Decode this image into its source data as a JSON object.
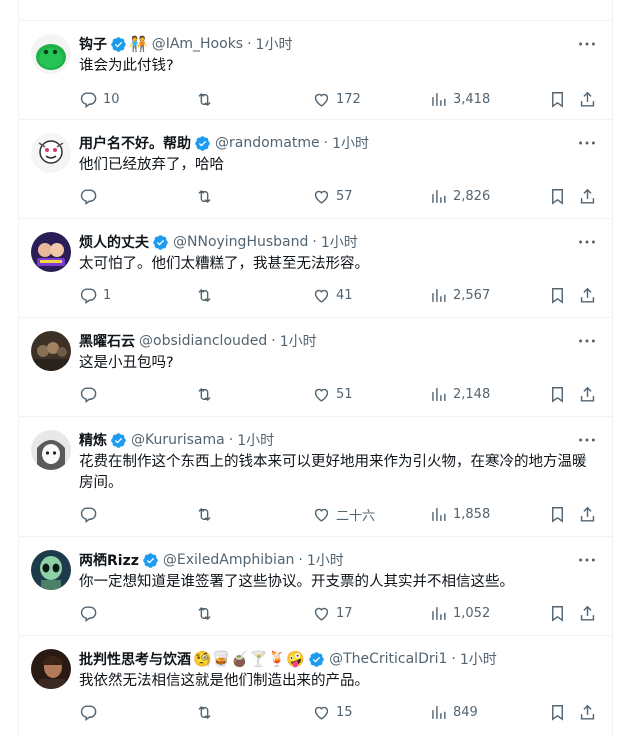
{
  "colors": {
    "verified": "#1d9bf0",
    "secondary_text": "#536471",
    "primary_text": "#0f1419",
    "divider": "#eff3f4"
  },
  "tweets": [
    {
      "name": "钩子",
      "extra_badge": "🧑‍🤝‍🧑",
      "handle": "@IAm_Hooks",
      "time": "1小时",
      "text": "谁会为此付钱?",
      "replies": "10",
      "retweets": "",
      "likes": "172",
      "views": "3,418",
      "avatar": "green-blob"
    },
    {
      "name": "用户名不好。帮助",
      "handle": "@randomatme",
      "time": "1小时",
      "text": "他们已经放弃了，哈哈",
      "replies": "",
      "retweets": "",
      "likes": "57",
      "views": "2,826",
      "avatar": "sketch-face"
    },
    {
      "name": "烦人的丈夫",
      "handle": "@NNoyingHusband",
      "time": "1小时",
      "text": "太可怕了。他们太糟糕了，我甚至无法形容。",
      "replies": "1",
      "retweets": "",
      "likes": "41",
      "views": "2,567",
      "avatar": "purple-duo"
    },
    {
      "name": "黑曜石云",
      "handle": "@obsidianclouded",
      "time": "1小时",
      "text": "这是小丑包吗?",
      "replies": "",
      "retweets": "",
      "likes": "51",
      "views": "2,148",
      "avatar": "dark-group"
    },
    {
      "name": "精炼",
      "handle": "@Kururisama",
      "time": "1小时",
      "text": "花费在制作这个东西上的钱本来可以更好地用来作为引火物，在寒冷的地方温暖房间。",
      "replies": "",
      "retweets": "",
      "likes": "二十六",
      "views": "1,858",
      "avatar": "anime-girl"
    },
    {
      "name": "两栖Rizz",
      "handle": "@ExiledAmphibian",
      "time": "1小时",
      "text": "你一定想知道是谁签署了这些协议。开支票的人其实并不相信这些。",
      "replies": "",
      "retweets": "",
      "likes": "17",
      "views": "1,052",
      "avatar": "alien"
    },
    {
      "name": "批判性思考与饮酒",
      "name_emojis": "🧐🥃🧉🍸🍹🤪",
      "handle": "@TheCriticalDri1",
      "time": "1小时",
      "text": "我依然无法相信这就是他们制造出来的产品。",
      "replies": "",
      "retweets": "",
      "likes": "15",
      "views": "849",
      "avatar": "man-portrait"
    }
  ],
  "icons": [
    "reply-icon",
    "retweet-icon",
    "like-icon",
    "views-icon",
    "bookmark-icon",
    "share-icon",
    "more-icon",
    "verified-icon"
  ]
}
